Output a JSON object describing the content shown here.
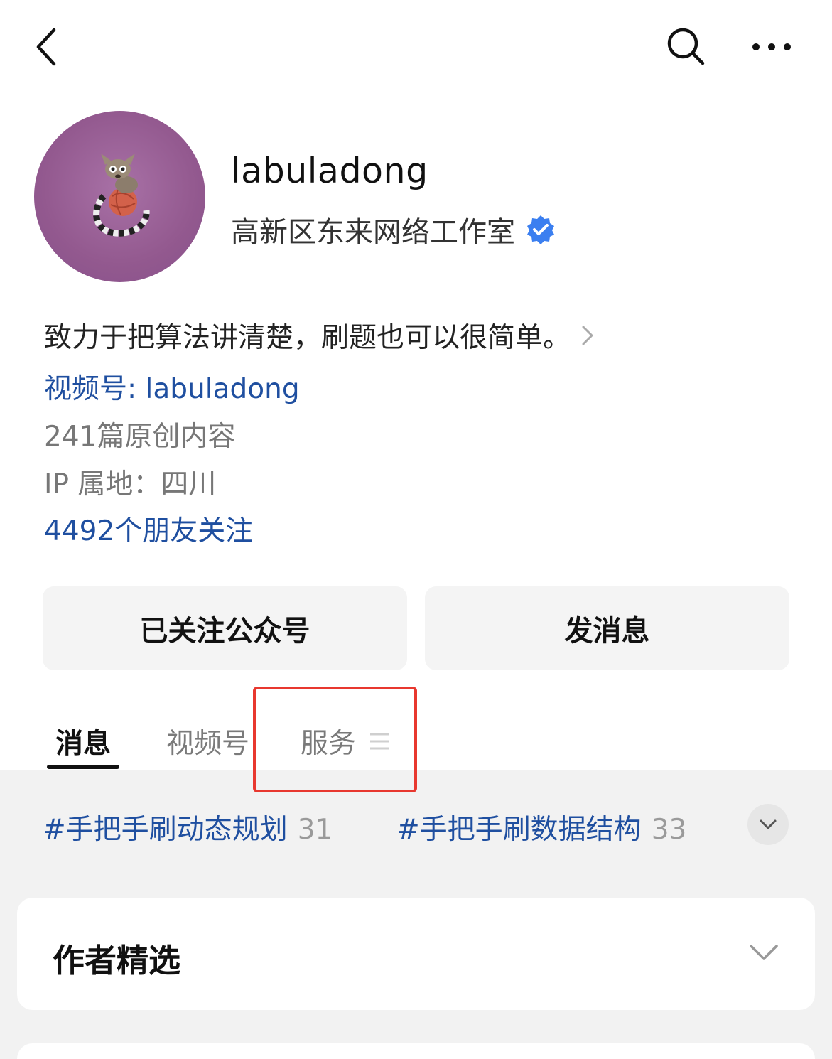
{
  "header": {
    "back_icon": "chevron-left-icon",
    "search_icon": "search-icon",
    "more_icon": "more-dots-icon"
  },
  "profile": {
    "name": "labuladong",
    "company": "高新区东来网络工作室",
    "verified_icon": "verified-badge-icon",
    "bio": "致力于把算法讲清楚，刷题也可以很简单。",
    "channel": "视频号: labuladong",
    "articles": "241篇原创内容",
    "ip": "IP 属地：四川",
    "friends": "4492个朋友关注"
  },
  "actions": {
    "follow_label": "已关注公众号",
    "message_label": "发消息"
  },
  "tabs": [
    {
      "label": "消息",
      "active": true
    },
    {
      "label": "视频号",
      "active": false
    },
    {
      "label": "服务",
      "active": false
    }
  ],
  "tags": [
    {
      "label": "#手把手刷动态规划",
      "count": "31"
    },
    {
      "label": "#手把手刷数据结构",
      "count": "33"
    }
  ],
  "sections": {
    "featured_title": "作者精选"
  },
  "colors": {
    "link_blue": "#1f4fa0",
    "verified_blue": "#3b7ff0",
    "highlight_red": "#e8382f",
    "avatar_purple": "#93598f"
  }
}
